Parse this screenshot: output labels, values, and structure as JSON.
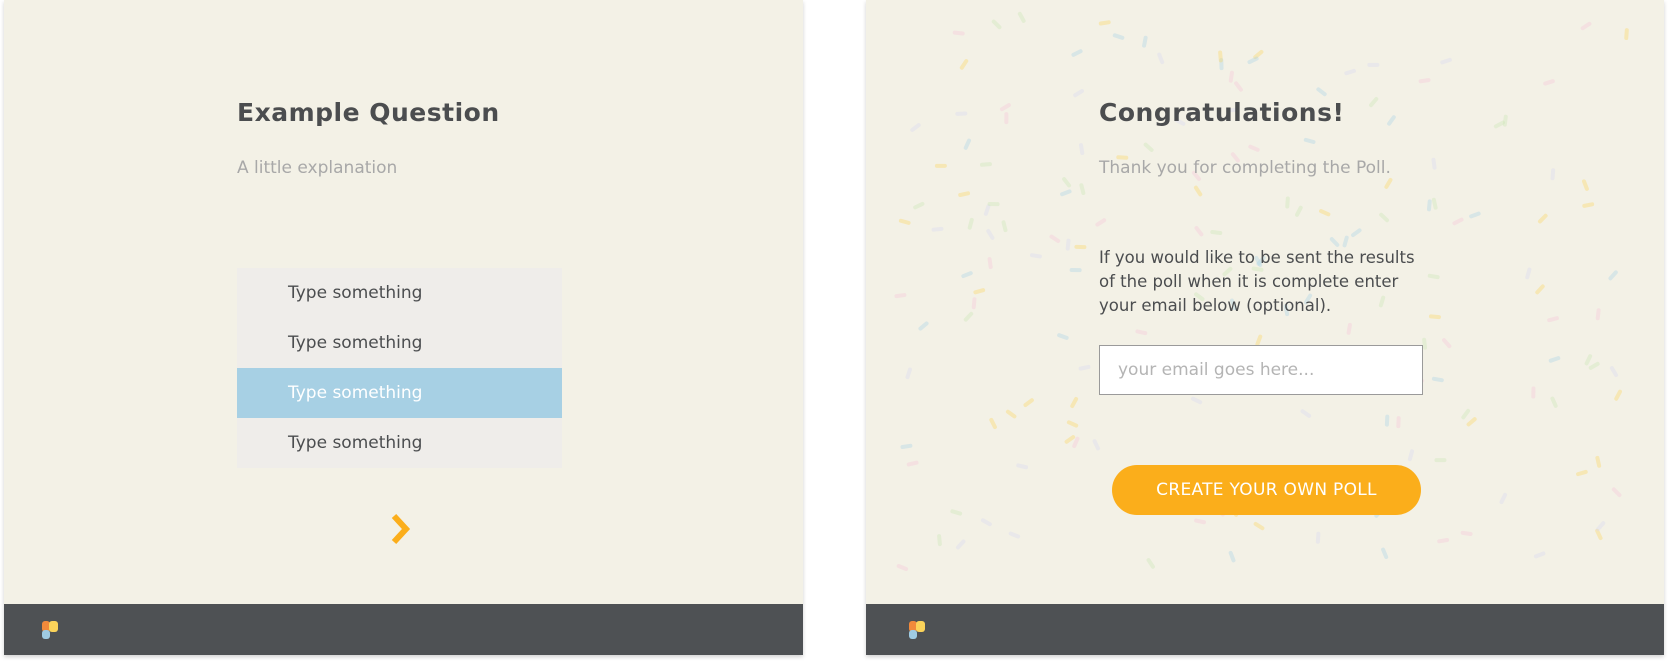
{
  "question_card": {
    "title": "Example Question",
    "subtitle": "A little explanation",
    "options": [
      {
        "label": "Type something",
        "selected": false
      },
      {
        "label": "Type something",
        "selected": false
      },
      {
        "label": "Type something",
        "selected": true
      },
      {
        "label": "Type something",
        "selected": false
      }
    ],
    "next_icon": "chevron-right-icon"
  },
  "completion_card": {
    "title": "Congratulations!",
    "subtitle": "Thank you for completing the Poll.",
    "info_text": "If you would like to be sent the results of the poll when it is complete enter your email below (optional).",
    "email": {
      "value": "",
      "placeholder": "your email goes here..."
    },
    "cta_label": "CREATE YOUR OWN POLL"
  },
  "footer": {
    "logo_icon": "app-logo-icon"
  },
  "colors": {
    "background": "#f3f1e6",
    "footer": "#4e5154",
    "accent": "#fbae1b",
    "selected_option": "#a7d0e4",
    "option_bg": "#efedea",
    "text_dark": "#4b4d4f",
    "text_muted": "#a8a8a8"
  }
}
